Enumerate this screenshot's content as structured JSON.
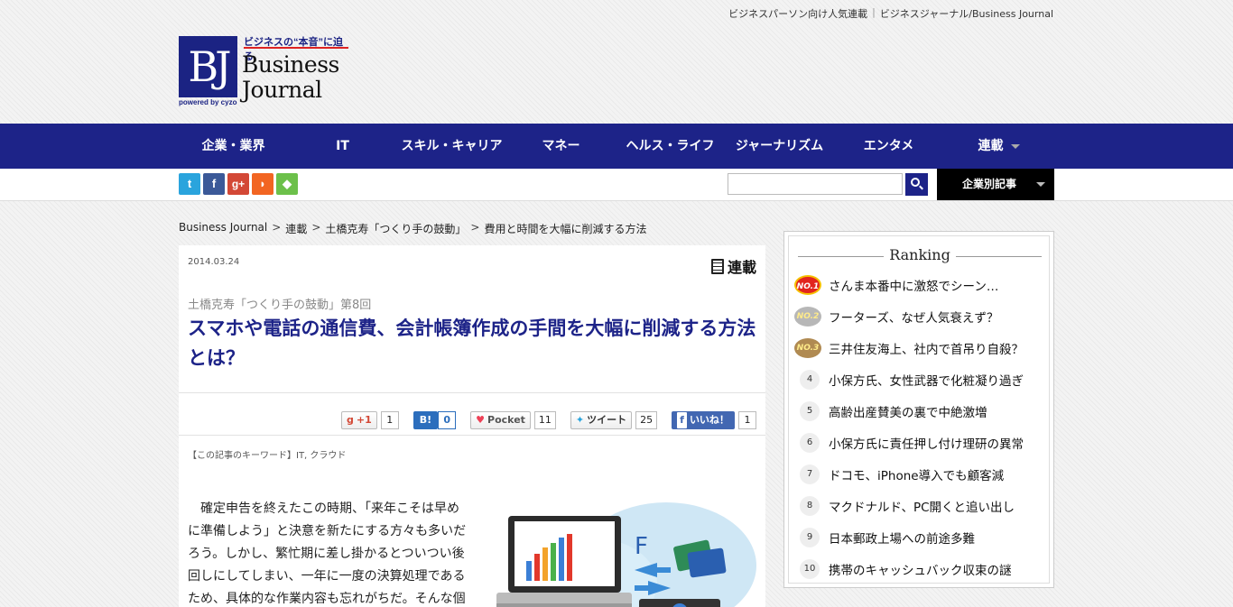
{
  "header": {
    "top_links": [
      "ビジネスパーソン向け人気連載",
      "ビジネスジャーナル/Business Journal"
    ],
    "logo": {
      "mark": "BJ",
      "tagline": "ビジネスの“本音”に迫る",
      "name_line1": "Business",
      "name_line2": "Journal",
      "powered": "powered by cyzo"
    }
  },
  "nav": {
    "items": [
      {
        "label": "企業・業界"
      },
      {
        "label": "IT"
      },
      {
        "label": "スキル・キャリア"
      },
      {
        "label": "マネー"
      },
      {
        "label": "ヘルス・ライフ"
      },
      {
        "label": "ジャーナリズム"
      },
      {
        "label": "エンタメ"
      },
      {
        "label": "連載"
      }
    ]
  },
  "social_icons": [
    {
      "name": "twitter-icon",
      "glyph": "t",
      "color": "#2aa4dd"
    },
    {
      "name": "facebook-icon",
      "glyph": "f",
      "color": "#3b5998"
    },
    {
      "name": "googleplus-icon",
      "glyph": "g+",
      "color": "#d34836"
    },
    {
      "name": "rss-icon",
      "glyph": "◗",
      "color": "#f26522"
    },
    {
      "name": "feedly-icon",
      "glyph": "◆",
      "color": "#6cc04a"
    }
  ],
  "search": {
    "placeholder": "",
    "value": ""
  },
  "company_button": {
    "label": "企業別記事"
  },
  "breadcrumb": [
    "Business Journal",
    "連載",
    "土橋克寿「つくり手の鼓動」",
    "費用と時間を大幅に削減する方法"
  ],
  "article": {
    "date": "2014.03.24",
    "badge": "連載",
    "series": "土橋克寿「つくり手の鼓動」第8回",
    "title": "スマホや電話の通信費、会計帳簿作成の手間を大幅に削減する方法とは？",
    "share": {
      "gplus": {
        "label": "+1",
        "count": "1"
      },
      "hatena": {
        "label": "B!",
        "count": "0"
      },
      "pocket": {
        "label": "Pocket",
        "count": "11"
      },
      "tweet": {
        "label": "ツイート",
        "count": "25"
      },
      "like": {
        "label": "いいね！",
        "count": "1"
      }
    },
    "keywords": "【この記事のキーワード】IT, クラウド",
    "body": "確定申告を終えたこの時期、「来年こそは早めに準備しよう」と決意を新たにする方々も多いだろう。しかし、繁忙期に差し掛かるとついつい後回しにしてしまい、一年に一度の決算処理であるため、具体的な作業内容も忘れがちだ。そんな個"
  },
  "ranking": {
    "title": "Ranking",
    "items": [
      {
        "rank": "NO.1",
        "text": "さんま本番中に激怒でシーン…",
        "medal_color": "#e2251e"
      },
      {
        "rank": "NO.2",
        "text": "フーターズ、なぜ人気衰えず？",
        "medal_color": "#b7b7b7"
      },
      {
        "rank": "NO.3",
        "text": "三井住友海上、社内で首吊り自殺？",
        "medal_color": "#b08a52"
      },
      {
        "rank": "4",
        "text": "小保方氏、女性武器で化粧凝り過ぎ"
      },
      {
        "rank": "5",
        "text": "高齢出産賛美の裏で中絶激増"
      },
      {
        "rank": "6",
        "text": "小保方氏に責任押し付け理研の異常"
      },
      {
        "rank": "7",
        "text": "ドコモ、iPhone導入でも顧客減"
      },
      {
        "rank": "8",
        "text": "マクドナルド、PC開くと追い出し"
      },
      {
        "rank": "9",
        "text": "日本郵政上場への前途多難"
      },
      {
        "rank": "10",
        "text": "携帯のキャッシュバック収束の謎"
      }
    ]
  }
}
